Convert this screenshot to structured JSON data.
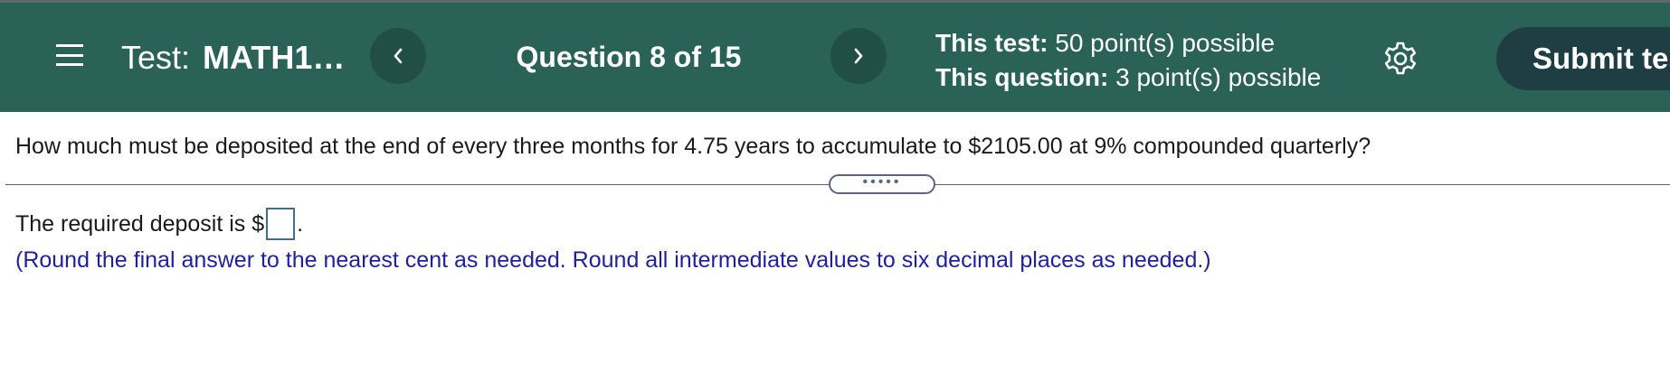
{
  "header": {
    "test_prefix": "Test:",
    "test_name": "MATH1…",
    "prev_label": "‹",
    "next_label": "›",
    "question_counter": "Question 8 of 15",
    "test_points_label": "This test:",
    "test_points_value": "50 point(s) possible",
    "question_points_label": "This question:",
    "question_points_value": "3 point(s) possible",
    "submit_label": "Submit test",
    "icons": [
      "menu-icon",
      "chevron-left-icon",
      "chevron-right-icon",
      "gear-icon"
    ],
    "colors": {
      "bar": "#2b6258",
      "nav_button": "#214f47",
      "submit_button": "#1f3e43"
    }
  },
  "question": {
    "text": "How much must be deposited at the end of every three months for 4.75 years to accumulate to $2105.00 at 9% compounded quarterly?"
  },
  "splitter": {
    "handle_label": "•••••"
  },
  "answer": {
    "prefix": "The required deposit is $",
    "value": "",
    "suffix": ".",
    "note": "(Round the final answer to the nearest cent as needed. Round all intermediate values to six decimal places as needed.)",
    "note_color": "#1f1fa0"
  }
}
